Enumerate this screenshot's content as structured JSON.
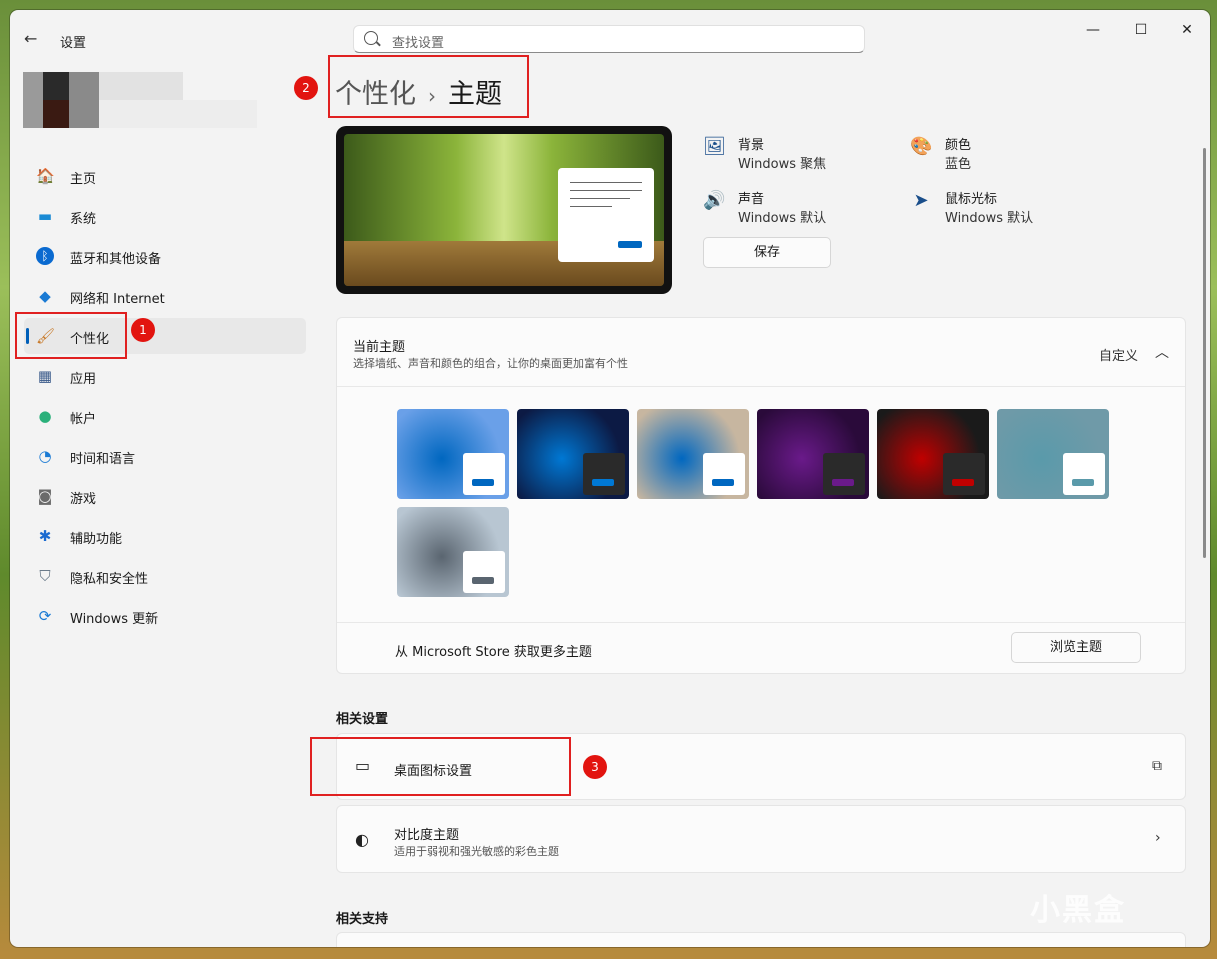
{
  "window": {
    "app_title": "设置",
    "back_icon": "arrow-left-icon",
    "controls": {
      "minimize": "—",
      "maximize": "☐",
      "close": "✕"
    }
  },
  "search": {
    "placeholder": "查找设置"
  },
  "nav": {
    "items": [
      {
        "label": "主页",
        "icon": "🏠"
      },
      {
        "label": "系统",
        "icon": "▬"
      },
      {
        "label": "蓝牙和其他设备",
        "icon": "ᛒ"
      },
      {
        "label": "网络和 Internet",
        "icon": "◆"
      },
      {
        "label": "个性化",
        "icon": "🖌"
      },
      {
        "label": "应用",
        "icon": "▦"
      },
      {
        "label": "帐户",
        "icon": "●"
      },
      {
        "label": "时间和语言",
        "icon": "◔"
      },
      {
        "label": "游戏",
        "icon": "◙"
      },
      {
        "label": "辅助功能",
        "icon": "✱"
      },
      {
        "label": "隐私和安全性",
        "icon": "⛉"
      },
      {
        "label": "Windows 更新",
        "icon": "⟳"
      }
    ],
    "active_index": 4
  },
  "badges": {
    "b1": "1",
    "b2": "2",
    "b3": "3"
  },
  "header": {
    "crumb": "个性化",
    "sep": "›",
    "title": "主题"
  },
  "props": {
    "background": {
      "title": "背景",
      "value": "Windows 聚焦"
    },
    "color": {
      "title": "颜色",
      "value": "蓝色"
    },
    "sound": {
      "title": "声音",
      "value": "Windows 默认"
    },
    "cursor": {
      "title": "鼠标光标",
      "value": "Windows 默认"
    },
    "save_label": "保存"
  },
  "current_theme": {
    "title": "当前主题",
    "subtitle": "选择墙纸、声音和颜色的组合，让你的桌面更加富有个性",
    "value": "自定义",
    "themes": [
      {
        "bg": "#6aa0e8",
        "mini": "#ffffff",
        "btn": "#0067c0"
      },
      {
        "bg": "#0c1a44",
        "mini": "#2a2a2a",
        "btn": "#0078d4"
      },
      {
        "bg": "#c7b6a0",
        "mini": "#ffffff",
        "btn": "#0067c0"
      },
      {
        "bg": "#2a0a3a",
        "mini": "#2a2a2a",
        "btn": "#6a1a8a"
      },
      {
        "bg": "#1a1a1a",
        "mini": "#2a2a2a",
        "btn": "#c00000"
      },
      {
        "bg": "#6f9aa8",
        "mini": "#ffffff",
        "btn": "#5a9aaa"
      },
      {
        "bg": "#b8c6d2",
        "mini": "#ffffff",
        "btn": "#5a6570"
      }
    ],
    "store_text": "从 Microsoft Store 获取更多主题",
    "browse_label": "浏览主题"
  },
  "related_settings": {
    "title": "相关设置",
    "desktop_icons": {
      "title": "桌面图标设置"
    },
    "contrast": {
      "title": "对比度主题",
      "subtitle": "适用于弱视和强光敏感的彩色主题"
    }
  },
  "related_support": {
    "title": "相关支持"
  },
  "watermark": "小黑盒"
}
